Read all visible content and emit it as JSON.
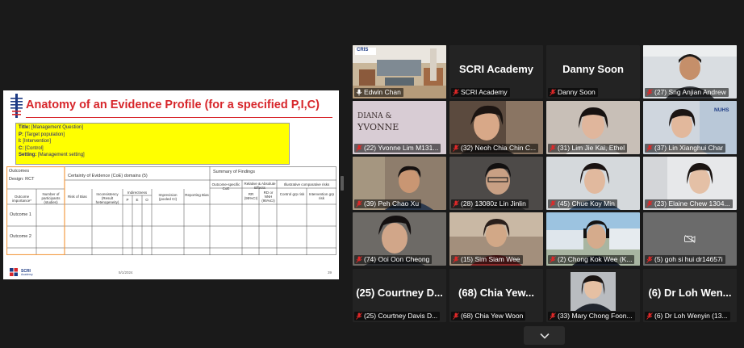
{
  "slide": {
    "title": "Anatomy of an Evidence Profile (for a specified P,I,C)",
    "pico": {
      "title_label": "Title:",
      "title_value": " [Management Question]",
      "p_label": "P:",
      "p_value": " [Target population]",
      "i_label": "I:",
      "i_value": " [Intervention]",
      "c_label": "C:",
      "c_value": " [Control]",
      "setting_label": "Setting:",
      "setting_value": " [Management setting]"
    },
    "table": {
      "outcomes": "Outcomes",
      "design": "Design: RCT",
      "coe_domains": "Certainty of Evidence (CoE) domains (5)",
      "summary": "Summary of Findings",
      "outcome_importance": "Outcome importance*",
      "participants": "Number of participants (studies)",
      "risk_of_bias": "Risk of Bias",
      "inconsistency": "Inconsistency (Result heterogeneity)",
      "indirectness": "Indirectness",
      "ind_p": "P",
      "ind_e": "E",
      "ind_o": "O",
      "imprecision": "Imprecision (pooled CI)",
      "reporting_bias": "Reporting Bias",
      "outcome_specific_coe": "Outcome-specific CoE",
      "relative_effects": "Relative & Absolute Effects",
      "rr": "RR (95%CI)",
      "rd": "RD or NNH (95%CI)",
      "illustrative": "Illustrative comparative risks",
      "control_risk": "Control grp risk",
      "intervention_risk": "Intervention grp risk",
      "outcome1": "Outcome 1",
      "outcome2": "Outcome 2"
    },
    "footer_brand": "SCRI",
    "footer_sub": "Academy",
    "date": "5/1/2024",
    "page": "39"
  },
  "participants": [
    {
      "label": "Edwin Chan",
      "muted": false,
      "active": true,
      "bigname": ""
    },
    {
      "label": "SCRI Academy",
      "muted": true,
      "bigname": "SCRI Academy"
    },
    {
      "label": "Danny Soon",
      "muted": true,
      "bigname": "Danny Soon"
    },
    {
      "label": "(27) Sng Anjian Andrew",
      "muted": true,
      "bigname": ""
    },
    {
      "label": "(22) Yvonne Lim M131...",
      "muted": true,
      "bigname": ""
    },
    {
      "label": "(32) Neoh Chia Chin C...",
      "muted": true,
      "bigname": ""
    },
    {
      "label": "(31) Lim Jie Kai, Ethel",
      "muted": true,
      "bigname": ""
    },
    {
      "label": "(37) Lin Xianghui Char",
      "muted": true,
      "bigname": ""
    },
    {
      "label": "(39) Peh Chao Xu",
      "muted": true,
      "bigname": ""
    },
    {
      "label": "(28) 13080z Lin Jinlin",
      "muted": true,
      "bigname": ""
    },
    {
      "label": "(45) Chue Koy Min",
      "muted": true,
      "bigname": ""
    },
    {
      "label": "(23) Elaine Chew 1304...",
      "muted": true,
      "bigname": ""
    },
    {
      "label": "(74) Ooi Oon Cheong",
      "muted": true,
      "bigname": ""
    },
    {
      "label": "(15) Sim Siam Wee",
      "muted": true,
      "bigname": ""
    },
    {
      "label": "(2) Chong Kok Wee (K...",
      "muted": true,
      "bigname": ""
    },
    {
      "label": "(5) goh si hui dr14657i",
      "muted": true,
      "bigname": ""
    },
    {
      "label": "(25) Courtney Davis D...",
      "muted": true,
      "bigname": "(25) Courtney D..."
    },
    {
      "label": "(68) Chia Yew Woon",
      "muted": true,
      "bigname": "(68) Chia Yew..."
    },
    {
      "label": "(33) Mary Chong Foon...",
      "muted": true,
      "bigname": ""
    },
    {
      "label": "(6) Dr Loh Wenyin (13...",
      "muted": true,
      "bigname": "(6) Dr Loh Wen..."
    }
  ],
  "tile_texts": {
    "cris_badge": "CRIS",
    "diana_text": "DIANA &",
    "yvonne_text": "YVONNE",
    "nuhs_text": "NUHS"
  },
  "colors": {
    "background": "#1a1a1a",
    "tile": "#232323",
    "active_border": "#e6e400",
    "muted_mic": "#e02828",
    "slide_title": "#d7262b",
    "pico_fill": "#ffff00"
  },
  "icons": {
    "muted": "mic-muted-icon",
    "mic": "mic-icon",
    "video_off": "video-off-icon",
    "chevron": "chevron-down-icon"
  }
}
